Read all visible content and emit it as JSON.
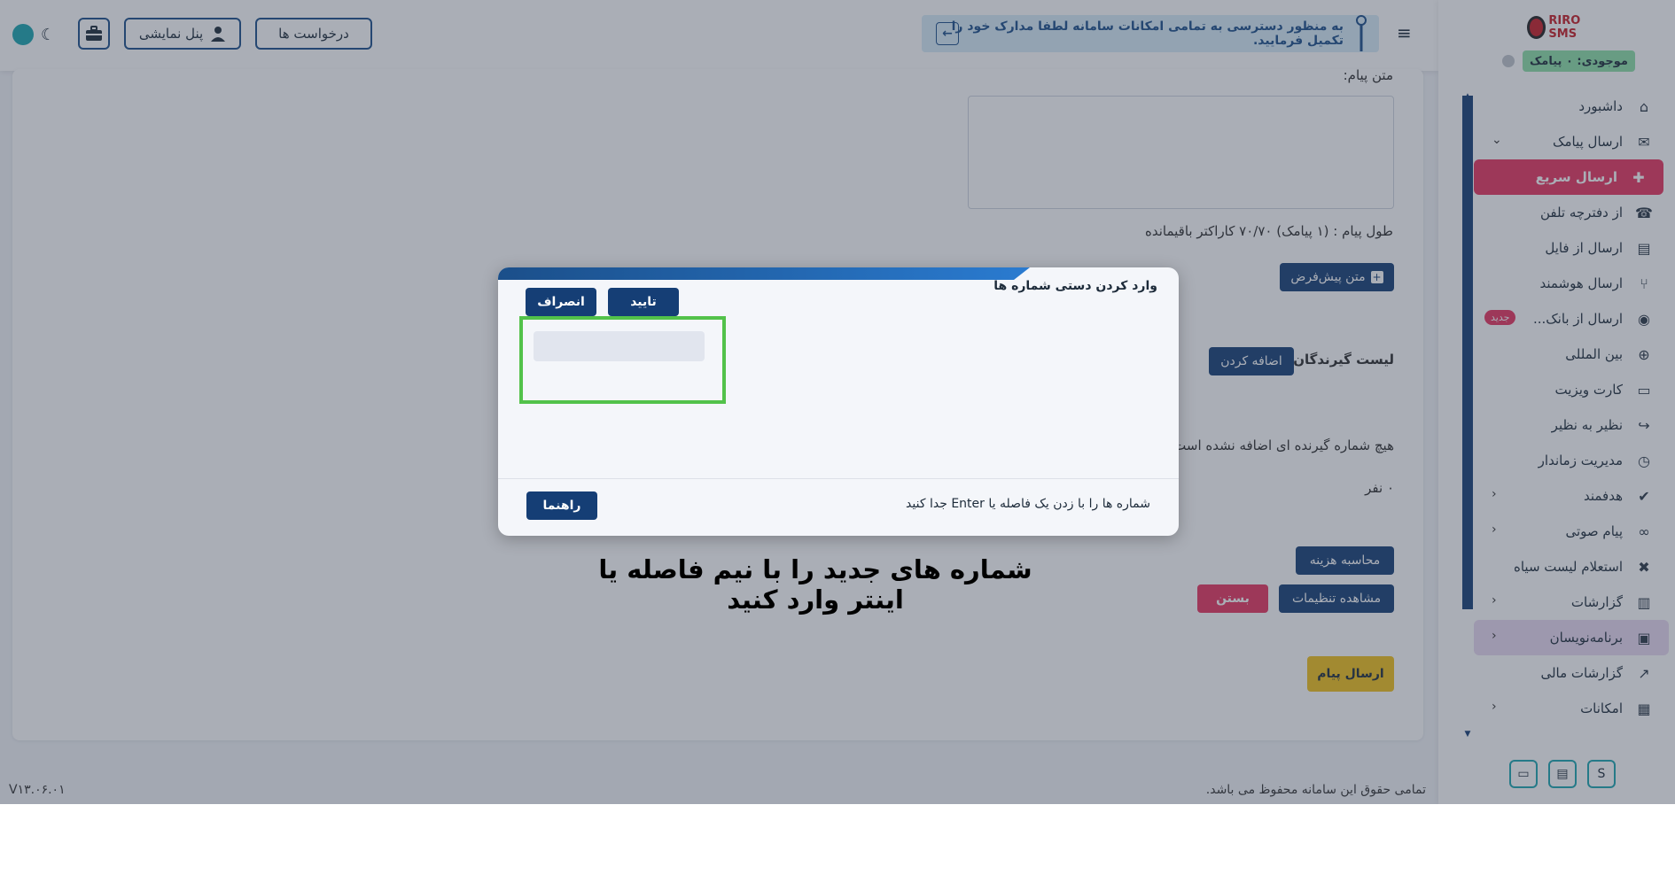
{
  "header": {
    "requests_label": "درخواست ها",
    "demo_panel_label": "پنل نمایشی",
    "notice_text": "به منظور دسترسی به تمامی امکانات سامانه لطفا مدارک خود را تکمیل فرمایید.",
    "notice_arrow": "←"
  },
  "form": {
    "message_text_label": "متن پیام:",
    "message_length": "طول پیام : (۱ پیامک) ۷۰/۷۰ کاراکتر باقیمانده",
    "default_text_button": "متن پیش‌فرض",
    "default_text_plus": "+",
    "recipients_label": "لیست گیرندگان :",
    "add_button": "اضافه کردن",
    "no_recipients": "هیچ شماره گیرنده ای اضافه نشده است",
    "count": "۰ نفر",
    "calc_cost_button": "محاسبه هزینه",
    "view_settings_button": "مشاهده تنظیمات",
    "close_button": "بستن",
    "send_button": "ارسال پیام"
  },
  "footer": {
    "version": "V۱۳.۰۶.۰۱",
    "copyright": "تمامی حقوق این سامانه محفوظ می باشد."
  },
  "sidebar": {
    "logo_text": "RIRO SMS",
    "credit": "موجودی: ۰ پیامک",
    "new_badge": "جدید",
    "items": [
      {
        "label": "داشبورد",
        "icon": "home-icon",
        "glyph": "⌂",
        "chevron": ""
      },
      {
        "label": "ارسال پیامک",
        "icon": "sms-icon",
        "glyph": "✉",
        "chevron": "⌄"
      },
      {
        "label": "ارسال سریع",
        "icon": "quick-send-icon",
        "glyph": "✚",
        "chevron": ""
      },
      {
        "label": "از دفترچه تلفن",
        "icon": "contacts-icon",
        "glyph": "☎",
        "chevron": ""
      },
      {
        "label": "ارسال از فایل",
        "icon": "file-icon",
        "glyph": "▤",
        "chevron": ""
      },
      {
        "label": "ارسال هوشمند",
        "icon": "smart-icon",
        "glyph": "⑂",
        "chevron": ""
      },
      {
        "label": "ارسال از بانک...",
        "icon": "database-icon",
        "glyph": "◉",
        "chevron": ""
      },
      {
        "label": "بین المللی",
        "icon": "globe-icon",
        "glyph": "⊕",
        "chevron": ""
      },
      {
        "label": "کارت ویزیت",
        "icon": "card-icon",
        "glyph": "▭",
        "chevron": ""
      },
      {
        "label": "نظیر به نظیر",
        "icon": "share-icon",
        "glyph": "↪",
        "chevron": ""
      },
      {
        "label": "مدیریت زماندار",
        "icon": "timer-icon",
        "glyph": "◷",
        "chevron": ""
      },
      {
        "label": "هدفمند",
        "icon": "target-icon",
        "glyph": "✔",
        "chevron": "‹"
      },
      {
        "label": "پیام صوتی",
        "icon": "voicemail-icon",
        "glyph": "∞",
        "chevron": "‹"
      },
      {
        "label": "استعلام لیست سیاه",
        "icon": "blacklist-icon",
        "glyph": "✖",
        "chevron": ""
      },
      {
        "label": "گزارشات",
        "icon": "report-icon",
        "glyph": "▥",
        "chevron": "‹"
      },
      {
        "label": "برنامه‌نویسان",
        "icon": "developer-icon",
        "glyph": "▣",
        "chevron": "‹"
      },
      {
        "label": "گزارشات مالی",
        "icon": "finance-icon",
        "glyph": "↗",
        "chevron": ""
      },
      {
        "label": "امکانات",
        "icon": "features-icon",
        "glyph": "▦",
        "chevron": "‹"
      }
    ],
    "bottom_s": "S"
  },
  "modal": {
    "title": "وارد کردن دستی شماره ها",
    "confirm_button": "تایید",
    "cancel_button": "انصراف",
    "input_placeholder": "",
    "hint": "شماره ها را با زدن یک فاصله یا Enter جدا کنید",
    "help_button": "راهنما"
  },
  "caption": "شماره های جدید را با نیم فاصله یا اینتر وارد کنید",
  "colors": {
    "navy": "#153e75",
    "accent_red": "#e8345f",
    "highlight_green": "#52c24a",
    "send_yellow": "#f2c21b",
    "teal": "#1aa6b0"
  }
}
